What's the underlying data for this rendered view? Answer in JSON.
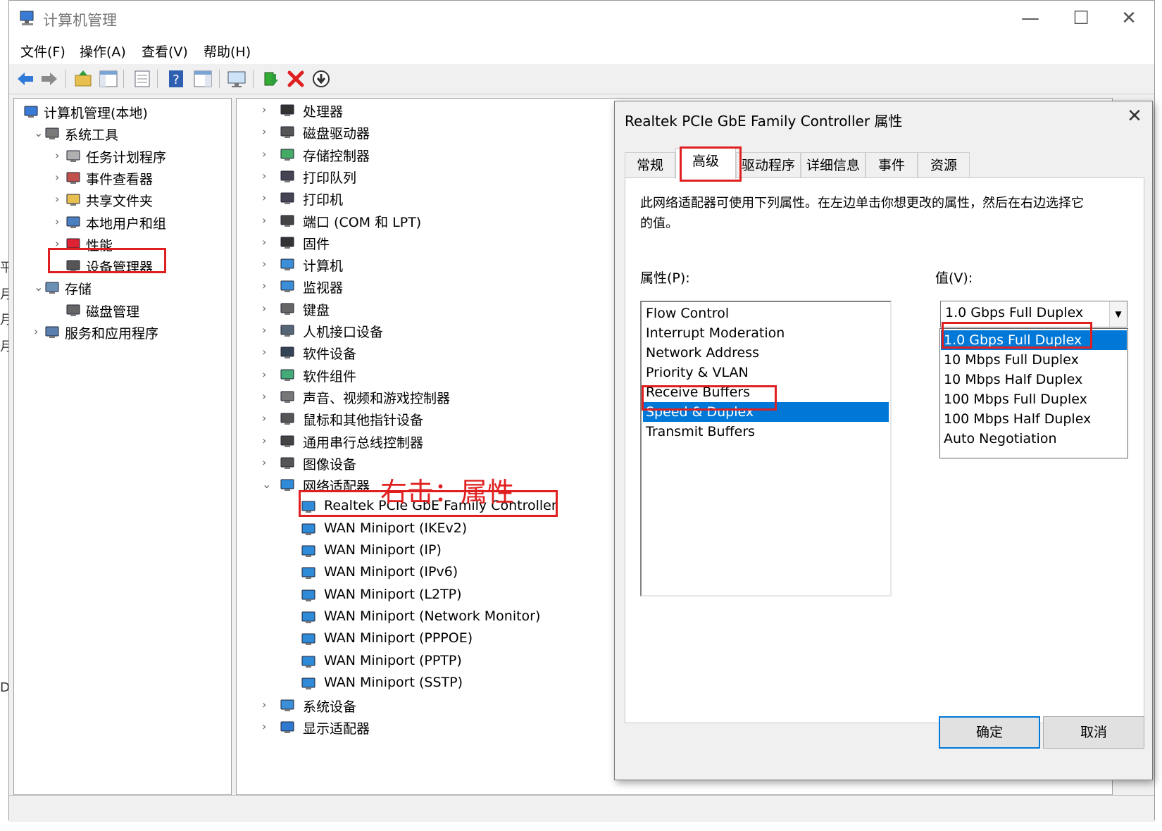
{
  "window": {
    "title": "计算机管理",
    "controls": {
      "minimize": "—",
      "maximize": "☐",
      "close": "✕"
    }
  },
  "menubar": [
    "文件(F)",
    "操作(A)",
    "查看(V)",
    "帮助(H)"
  ],
  "toolbar_icons": [
    "back-icon",
    "forward-icon",
    "up-folder-icon",
    "show-hide-console-tree-icon",
    "properties-icon",
    "help-icon",
    "show-action-pane-icon",
    "monitor-icon",
    "update-driver-icon",
    "uninstall-icon",
    "download-icon"
  ],
  "left_tree": [
    {
      "label": "计算机管理(本地)",
      "icon": "computer-management-icon",
      "level": 0,
      "expander": ""
    },
    {
      "label": "系统工具",
      "icon": "tools-icon",
      "level": 1,
      "expander": "⌄"
    },
    {
      "label": "任务计划程序",
      "icon": "clock-icon",
      "level": 2,
      "expander": "›"
    },
    {
      "label": "事件查看器",
      "icon": "event-viewer-icon",
      "level": 2,
      "expander": "›"
    },
    {
      "label": "共享文件夹",
      "icon": "shared-folder-icon",
      "level": 2,
      "expander": "›"
    },
    {
      "label": "本地用户和组",
      "icon": "users-icon",
      "level": 2,
      "expander": "›"
    },
    {
      "label": "性能",
      "icon": "performance-icon",
      "level": 2,
      "expander": "›"
    },
    {
      "label": "设备管理器",
      "icon": "device-manager-icon",
      "level": 2,
      "expander": ""
    },
    {
      "label": "存储",
      "icon": "storage-icon",
      "level": 1,
      "expander": "⌄"
    },
    {
      "label": "磁盘管理",
      "icon": "disk-management-icon",
      "level": 2,
      "expander": ""
    },
    {
      "label": "服务和应用程序",
      "icon": "services-icon",
      "level": 1,
      "expander": "›"
    }
  ],
  "device_tree": [
    {
      "label": "处理器",
      "icon": "processor-icon",
      "expander": "›",
      "child": false
    },
    {
      "label": "磁盘驱动器",
      "icon": "disk-drive-icon",
      "expander": "›",
      "child": false
    },
    {
      "label": "存储控制器",
      "icon": "storage-controller-icon",
      "expander": "›",
      "child": false
    },
    {
      "label": "打印队列",
      "icon": "print-queue-icon",
      "expander": "›",
      "child": false
    },
    {
      "label": "打印机",
      "icon": "printer-icon",
      "expander": "›",
      "child": false
    },
    {
      "label": "端口 (COM 和 LPT)",
      "icon": "port-icon",
      "expander": "›",
      "child": false
    },
    {
      "label": "固件",
      "icon": "firmware-icon",
      "expander": "›",
      "child": false
    },
    {
      "label": "计算机",
      "icon": "computer-icon",
      "expander": "›",
      "child": false
    },
    {
      "label": "监视器",
      "icon": "monitor-icon",
      "expander": "›",
      "child": false
    },
    {
      "label": "键盘",
      "icon": "keyboard-icon",
      "expander": "›",
      "child": false
    },
    {
      "label": "人机接口设备",
      "icon": "hid-icon",
      "expander": "›",
      "child": false
    },
    {
      "label": "软件设备",
      "icon": "software-device-icon",
      "expander": "›",
      "child": false
    },
    {
      "label": "软件组件",
      "icon": "software-component-icon",
      "expander": "›",
      "child": false
    },
    {
      "label": "声音、视频和游戏控制器",
      "icon": "sound-icon",
      "expander": "›",
      "child": false
    },
    {
      "label": "鼠标和其他指针设备",
      "icon": "mouse-icon",
      "expander": "›",
      "child": false
    },
    {
      "label": "通用串行总线控制器",
      "icon": "usb-icon",
      "expander": "›",
      "child": false
    },
    {
      "label": "图像设备",
      "icon": "camera-icon",
      "expander": "›",
      "child": false
    },
    {
      "label": "网络适配器",
      "icon": "network-adapter-icon",
      "expander": "⌄",
      "child": false
    },
    {
      "label": "Realtek PCIe GbE Family Controller",
      "icon": "network-adapter-icon",
      "expander": "",
      "child": true
    },
    {
      "label": "WAN Miniport (IKEv2)",
      "icon": "network-adapter-icon",
      "expander": "",
      "child": true
    },
    {
      "label": "WAN Miniport (IP)",
      "icon": "network-adapter-icon",
      "expander": "",
      "child": true
    },
    {
      "label": "WAN Miniport (IPv6)",
      "icon": "network-adapter-icon",
      "expander": "",
      "child": true
    },
    {
      "label": "WAN Miniport (L2TP)",
      "icon": "network-adapter-icon",
      "expander": "",
      "child": true
    },
    {
      "label": "WAN Miniport (Network Monitor)",
      "icon": "network-adapter-icon",
      "expander": "",
      "child": true
    },
    {
      "label": "WAN Miniport (PPPOE)",
      "icon": "network-adapter-icon",
      "expander": "",
      "child": true
    },
    {
      "label": "WAN Miniport (PPTP)",
      "icon": "network-adapter-icon",
      "expander": "",
      "child": true
    },
    {
      "label": "WAN Miniport (SSTP)",
      "icon": "network-adapter-icon",
      "expander": "",
      "child": true
    },
    {
      "label": "系统设备",
      "icon": "system-device-icon",
      "expander": "›",
      "child": false
    },
    {
      "label": "显示适配器",
      "icon": "display-adapter-icon",
      "expander": "›",
      "child": false
    }
  ],
  "annotation": "右击：属性",
  "edge_text": [
    "平",
    "月",
    "月",
    "月",
    "D:"
  ],
  "dialog": {
    "title": "Realtek PCIe GbE Family Controller 属性",
    "close": "✕",
    "tabs": [
      "常规",
      "高级",
      "驱动程序",
      "详细信息",
      "事件",
      "资源"
    ],
    "active_tab": "高级",
    "description": "此网络适配器可使用下列属性。在左边单击你想更改的属性，然后在右边选择它的值。",
    "property_label": "属性(P):",
    "value_label": "值(V):",
    "properties": [
      "Flow Control",
      "Interrupt Moderation",
      "Network Address",
      "Priority & VLAN",
      "Receive Buffers",
      "Speed & Duplex",
      "Transmit Buffers"
    ],
    "selected_property": "Speed & Duplex",
    "value_current": "1.0 Gbps Full Duplex",
    "value_options": [
      "1.0 Gbps Full Duplex",
      "10 Mbps Full Duplex",
      "10 Mbps Half Duplex",
      "100 Mbps Full Duplex",
      "100 Mbps Half Duplex",
      "Auto Negotiation"
    ],
    "ok": "确定",
    "cancel": "取消"
  },
  "colors": {
    "selection": "#0078d7",
    "highlight_box": "#e02020"
  }
}
